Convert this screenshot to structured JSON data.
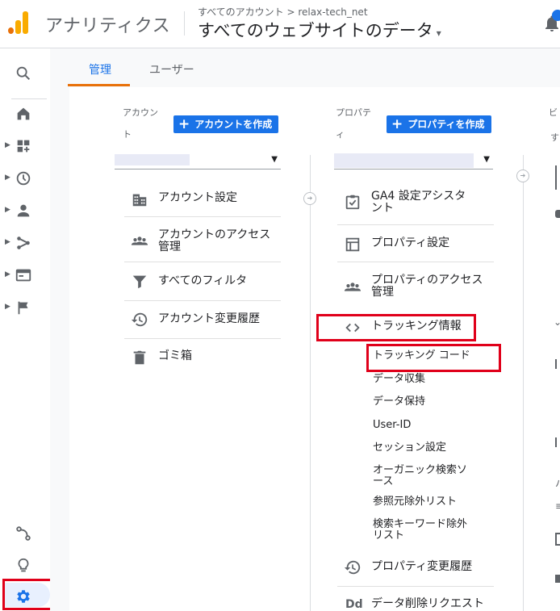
{
  "header": {
    "app_title": "アナリティクス",
    "breadcrumb": "すべてのアカウント > relax-tech_net",
    "property_title": "すべてのウェブサイトのデータ",
    "caret": "▾"
  },
  "tabs": [
    {
      "label": "管理",
      "active": true
    },
    {
      "label": "ユーザー",
      "active": false
    }
  ],
  "account_column": {
    "label_line1": "アカウン",
    "label_line2": "ト",
    "create_button": "アカウントを作成",
    "items": [
      {
        "label": "アカウント設定",
        "icon": "building-icon"
      },
      {
        "label": "アカウントのアクセス管理",
        "icon": "people-icon"
      },
      {
        "label": "すべてのフィルタ",
        "icon": "filter-icon"
      },
      {
        "label": "アカウント変更履歴",
        "icon": "history-icon"
      },
      {
        "label": "ゴミ箱",
        "icon": "trash-icon"
      }
    ]
  },
  "property_column": {
    "label_line1": "プロパテ",
    "label_line2": "ィ",
    "create_button": "プロパティを作成",
    "items": [
      {
        "label": "GA4 設定アシスタント",
        "icon": "checklist-icon"
      },
      {
        "label": "プロパティ設定",
        "icon": "layout-icon"
      },
      {
        "label": "プロパティのアクセス管理",
        "icon": "people-icon"
      },
      {
        "label": "トラッキング情報",
        "icon": "code-icon"
      },
      {
        "label": "プロパティ変更履歴",
        "icon": "history-icon"
      },
      {
        "label": "データ削除リクエスト",
        "icon": "dd-icon"
      }
    ],
    "tracking_sub": [
      "トラッキング コード",
      "データ収集",
      "データ保持",
      "User-ID",
      "セッション設定",
      "オーガニック検索ソース",
      "参照元除外リスト",
      "検索キーワード除外リスト"
    ],
    "dd_label": "Dd"
  },
  "view_column": {
    "label": "ビ",
    "sub": "す"
  },
  "colors": {
    "accent": "#1a73e8",
    "tab_underline": "#e8710a",
    "highlight": "#e0001a"
  }
}
